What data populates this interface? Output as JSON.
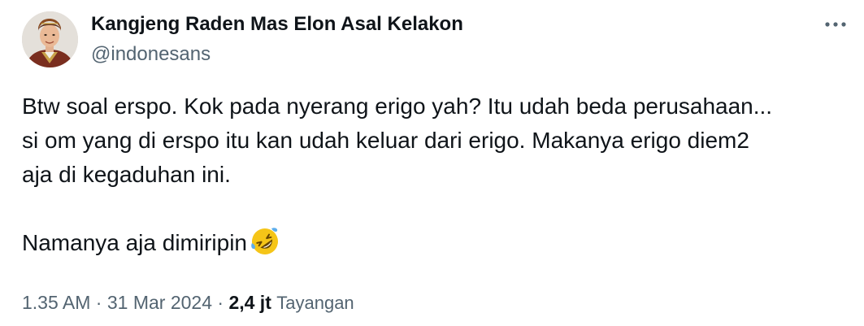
{
  "author": {
    "display_name": "Kangjeng Raden Mas Elon Asal Kelakon",
    "handle": "@indonesans",
    "avatar_icon": "profile-photo"
  },
  "more_icon": "more-options-icon",
  "tweet": {
    "lines": [
      "Btw soal erspo. Kok pada nyerang erigo yah? Itu udah beda perusahaan...",
      "si om yang di erspo itu kan udah keluar dari erigo. Makanya erigo diem2",
      "aja di kegaduhan ini."
    ],
    "final_line": "Namanya aja dimiripin",
    "emoji_icon": "rolling-on-the-floor-laughing-emoji"
  },
  "meta": {
    "time": "1.35 AM",
    "separator": "·",
    "date": "31 Mar 2024",
    "views_count": "2,4 jt",
    "views_label": "Tayangan"
  },
  "colors": {
    "text_primary": "#0f1419",
    "text_secondary": "#536471",
    "emoji_yellow": "#f5c518",
    "tear_blue": "#5dadec"
  }
}
